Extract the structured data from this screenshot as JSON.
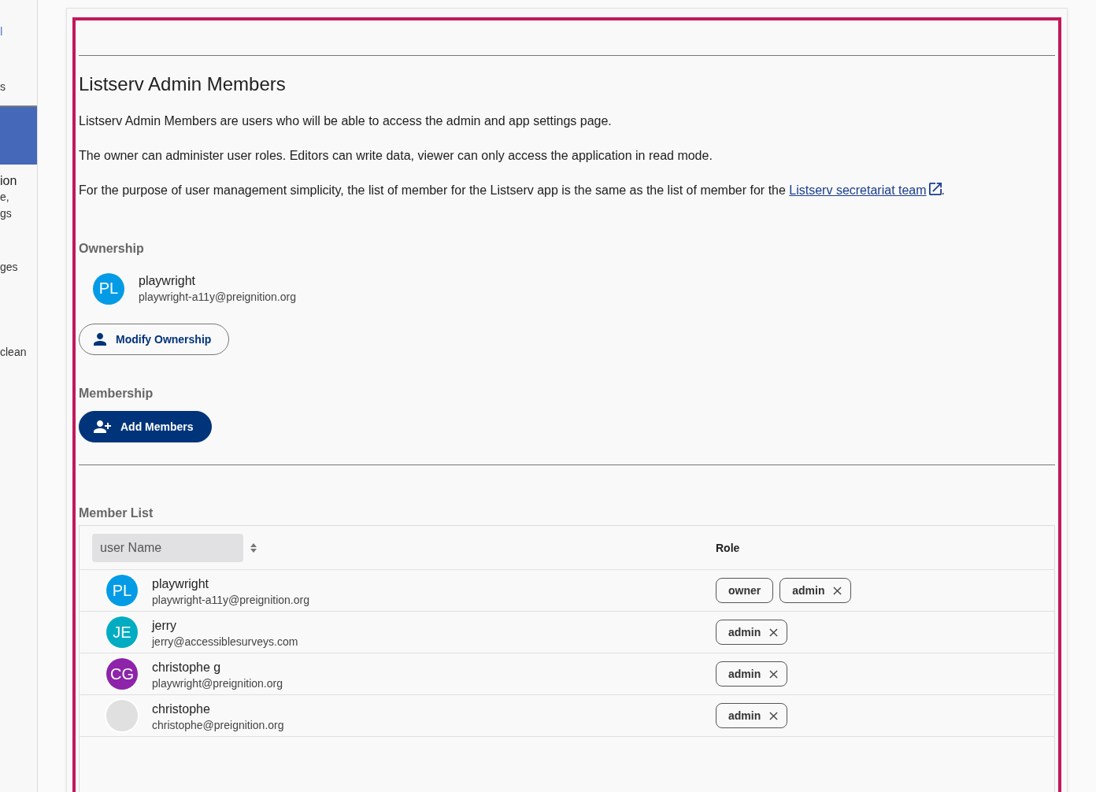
{
  "sidebar": {
    "items": [
      {
        "kind": "link",
        "label": "l",
        "selected": false
      },
      {
        "kind": "item",
        "label": "s",
        "selected": false
      },
      {
        "kind": "item",
        "selected": true
      },
      {
        "kind": "card",
        "title": "ion",
        "lines": [
          "e,",
          "gs"
        ],
        "selected": false
      },
      {
        "kind": "item",
        "label": "ges",
        "selected": false
      },
      {
        "kind": "item",
        "label": "clean",
        "selected": false
      }
    ]
  },
  "panel": {
    "focused": true,
    "title": "Listserv Admin Members",
    "paragraphs": [
      "Listserv Admin Members are users who will be able to access the admin and app settings page.",
      "The owner can administer user roles. Editors can write data, viewer can only access the application in read mode."
    ],
    "note": {
      "text": "For the purpose of user management simplicity, the list of member for the Listserv app is the same as the list of member for the ",
      "link": "Listserv secretariat team",
      "after": "."
    },
    "ownership": {
      "heading": "Ownership",
      "owner": {
        "initials": "PL",
        "color": "#039be5",
        "name": "playwright",
        "email": "playwright-a11y@preignition.org"
      },
      "button": "Modify Ownership"
    },
    "membership": {
      "heading": "Membership",
      "button": "Add Members"
    },
    "member_list": {
      "heading": "Member List",
      "filter": {
        "placeholder": "user Name"
      },
      "columns": [
        "Role"
      ],
      "rows": [
        {
          "initials": "PL",
          "color": "#039be5",
          "name": "playwright",
          "email": "playwright-a11y@preignition.org",
          "roles": [
            {
              "label": "owner",
              "removable": false
            },
            {
              "label": "admin",
              "removable": true
            }
          ]
        },
        {
          "initials": "JE",
          "color": "#00acc1",
          "name": "jerry",
          "email": "jerry@accessiblesurveys.com",
          "roles": [
            {
              "label": "admin",
              "removable": true
            }
          ]
        },
        {
          "initials": "CG",
          "color": "#8e24aa",
          "name": "christophe g",
          "email": "playwright@preignition.org",
          "roles": [
            {
              "label": "admin",
              "removable": true
            }
          ]
        },
        {
          "color": "#e0e0e0",
          "name": "christophe",
          "email": "christophe@preignition.org",
          "roles": [
            {
              "label": "admin",
              "removable": true
            }
          ]
        }
      ]
    }
  }
}
